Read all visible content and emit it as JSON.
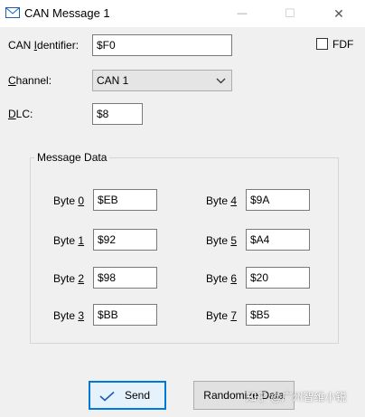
{
  "window": {
    "title": "CAN Message 1",
    "minimize_glyph": "—",
    "maximize_glyph": "☐",
    "close_glyph": "✕"
  },
  "form": {
    "identifier_label_pre": "CAN ",
    "identifier_label_u": "I",
    "identifier_label_post": "dentifier:",
    "identifier_value": "$F0",
    "fdf_label": "FDF",
    "fdf_checked": false,
    "channel_label_u": "C",
    "channel_label_post": "hannel:",
    "channel_value": "CAN 1",
    "dlc_label_u": "D",
    "dlc_label_post": "LC:",
    "dlc_value": "$8"
  },
  "message_data": {
    "group_title": "Message Data",
    "bytes": [
      {
        "label": "Byte ",
        "index": "0",
        "value": "$EB"
      },
      {
        "label": "Byte ",
        "index": "1",
        "value": "$92"
      },
      {
        "label": "Byte ",
        "index": "2",
        "value": "$98"
      },
      {
        "label": "Byte ",
        "index": "3",
        "value": "$BB"
      },
      {
        "label": "Byte ",
        "index": "4",
        "value": "$9A"
      },
      {
        "label": "Byte ",
        "index": "5",
        "value": "$A4"
      },
      {
        "label": "Byte ",
        "index": "6",
        "value": "$20"
      },
      {
        "label": "Byte ",
        "index": "7",
        "value": "$B5"
      }
    ]
  },
  "buttons": {
    "send_label": "Send",
    "randomize_label": "Randomize Data"
  },
  "watermark": "知乎 @广州智维小锐",
  "icons": {
    "title": "envelope-icon",
    "send": "checkmark-icon",
    "channel": "chevron-down-icon"
  },
  "colors": {
    "client_bg": "#f0f0f0",
    "focus_border": "#0078d7"
  }
}
